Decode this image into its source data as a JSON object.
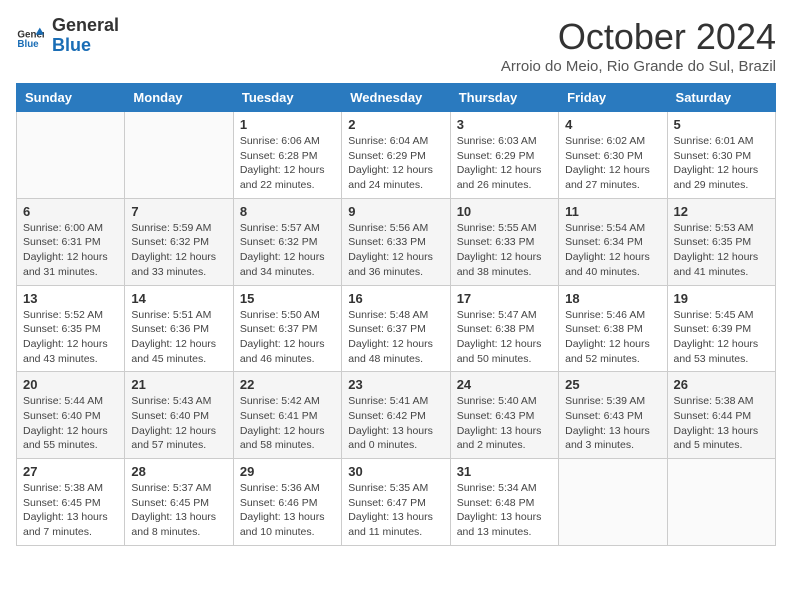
{
  "logo": {
    "line1": "General",
    "line2": "Blue"
  },
  "title": "October 2024",
  "subtitle": "Arroio do Meio, Rio Grande do Sul, Brazil",
  "weekdays": [
    "Sunday",
    "Monday",
    "Tuesday",
    "Wednesday",
    "Thursday",
    "Friday",
    "Saturday"
  ],
  "weeks": [
    [
      {
        "day": "",
        "info": ""
      },
      {
        "day": "",
        "info": ""
      },
      {
        "day": "1",
        "info": "Sunrise: 6:06 AM\nSunset: 6:28 PM\nDaylight: 12 hours and 22 minutes."
      },
      {
        "day": "2",
        "info": "Sunrise: 6:04 AM\nSunset: 6:29 PM\nDaylight: 12 hours and 24 minutes."
      },
      {
        "day": "3",
        "info": "Sunrise: 6:03 AM\nSunset: 6:29 PM\nDaylight: 12 hours and 26 minutes."
      },
      {
        "day": "4",
        "info": "Sunrise: 6:02 AM\nSunset: 6:30 PM\nDaylight: 12 hours and 27 minutes."
      },
      {
        "day": "5",
        "info": "Sunrise: 6:01 AM\nSunset: 6:30 PM\nDaylight: 12 hours and 29 minutes."
      }
    ],
    [
      {
        "day": "6",
        "info": "Sunrise: 6:00 AM\nSunset: 6:31 PM\nDaylight: 12 hours and 31 minutes."
      },
      {
        "day": "7",
        "info": "Sunrise: 5:59 AM\nSunset: 6:32 PM\nDaylight: 12 hours and 33 minutes."
      },
      {
        "day": "8",
        "info": "Sunrise: 5:57 AM\nSunset: 6:32 PM\nDaylight: 12 hours and 34 minutes."
      },
      {
        "day": "9",
        "info": "Sunrise: 5:56 AM\nSunset: 6:33 PM\nDaylight: 12 hours and 36 minutes."
      },
      {
        "day": "10",
        "info": "Sunrise: 5:55 AM\nSunset: 6:33 PM\nDaylight: 12 hours and 38 minutes."
      },
      {
        "day": "11",
        "info": "Sunrise: 5:54 AM\nSunset: 6:34 PM\nDaylight: 12 hours and 40 minutes."
      },
      {
        "day": "12",
        "info": "Sunrise: 5:53 AM\nSunset: 6:35 PM\nDaylight: 12 hours and 41 minutes."
      }
    ],
    [
      {
        "day": "13",
        "info": "Sunrise: 5:52 AM\nSunset: 6:35 PM\nDaylight: 12 hours and 43 minutes."
      },
      {
        "day": "14",
        "info": "Sunrise: 5:51 AM\nSunset: 6:36 PM\nDaylight: 12 hours and 45 minutes."
      },
      {
        "day": "15",
        "info": "Sunrise: 5:50 AM\nSunset: 6:37 PM\nDaylight: 12 hours and 46 minutes."
      },
      {
        "day": "16",
        "info": "Sunrise: 5:48 AM\nSunset: 6:37 PM\nDaylight: 12 hours and 48 minutes."
      },
      {
        "day": "17",
        "info": "Sunrise: 5:47 AM\nSunset: 6:38 PM\nDaylight: 12 hours and 50 minutes."
      },
      {
        "day": "18",
        "info": "Sunrise: 5:46 AM\nSunset: 6:38 PM\nDaylight: 12 hours and 52 minutes."
      },
      {
        "day": "19",
        "info": "Sunrise: 5:45 AM\nSunset: 6:39 PM\nDaylight: 12 hours and 53 minutes."
      }
    ],
    [
      {
        "day": "20",
        "info": "Sunrise: 5:44 AM\nSunset: 6:40 PM\nDaylight: 12 hours and 55 minutes."
      },
      {
        "day": "21",
        "info": "Sunrise: 5:43 AM\nSunset: 6:40 PM\nDaylight: 12 hours and 57 minutes."
      },
      {
        "day": "22",
        "info": "Sunrise: 5:42 AM\nSunset: 6:41 PM\nDaylight: 12 hours and 58 minutes."
      },
      {
        "day": "23",
        "info": "Sunrise: 5:41 AM\nSunset: 6:42 PM\nDaylight: 13 hours and 0 minutes."
      },
      {
        "day": "24",
        "info": "Sunrise: 5:40 AM\nSunset: 6:43 PM\nDaylight: 13 hours and 2 minutes."
      },
      {
        "day": "25",
        "info": "Sunrise: 5:39 AM\nSunset: 6:43 PM\nDaylight: 13 hours and 3 minutes."
      },
      {
        "day": "26",
        "info": "Sunrise: 5:38 AM\nSunset: 6:44 PM\nDaylight: 13 hours and 5 minutes."
      }
    ],
    [
      {
        "day": "27",
        "info": "Sunrise: 5:38 AM\nSunset: 6:45 PM\nDaylight: 13 hours and 7 minutes."
      },
      {
        "day": "28",
        "info": "Sunrise: 5:37 AM\nSunset: 6:45 PM\nDaylight: 13 hours and 8 minutes."
      },
      {
        "day": "29",
        "info": "Sunrise: 5:36 AM\nSunset: 6:46 PM\nDaylight: 13 hours and 10 minutes."
      },
      {
        "day": "30",
        "info": "Sunrise: 5:35 AM\nSunset: 6:47 PM\nDaylight: 13 hours and 11 minutes."
      },
      {
        "day": "31",
        "info": "Sunrise: 5:34 AM\nSunset: 6:48 PM\nDaylight: 13 hours and 13 minutes."
      },
      {
        "day": "",
        "info": ""
      },
      {
        "day": "",
        "info": ""
      }
    ]
  ]
}
